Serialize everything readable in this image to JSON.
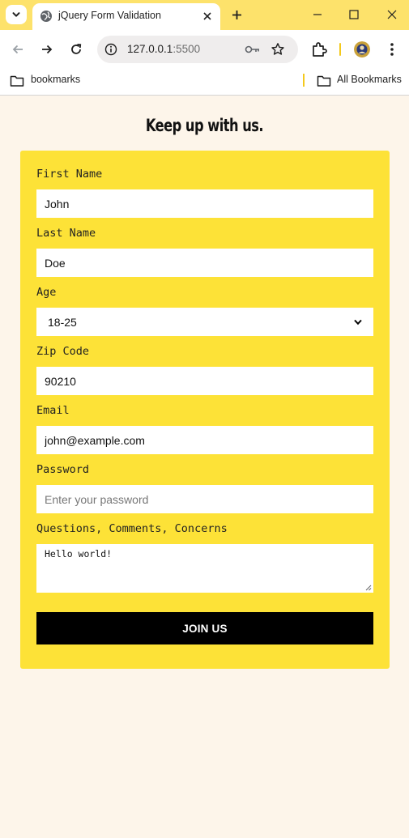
{
  "browser": {
    "tab_title": "jQuery Form Validation",
    "url_host": "127.0.0.1",
    "url_port": ":5500",
    "bookmarks": {
      "left_folder": "bookmarks",
      "right_folder": "All Bookmarks"
    },
    "accent_color": "#fde26b"
  },
  "page": {
    "heading": "Keep up with us.",
    "card_color": "#fde237",
    "form": {
      "first_name": {
        "label": "First Name",
        "value": "John"
      },
      "last_name": {
        "label": "Last Name",
        "value": "Doe"
      },
      "age": {
        "label": "Age",
        "selected": "18-25"
      },
      "zip": {
        "label": "Zip Code",
        "value": "90210"
      },
      "email": {
        "label": "Email",
        "value": "john@example.com"
      },
      "password": {
        "label": "Password",
        "value": "",
        "placeholder": "Enter your password"
      },
      "comments": {
        "label": "Questions, Comments, Concerns",
        "value": "Hello world!"
      },
      "submit_label": "JOIN US"
    }
  }
}
